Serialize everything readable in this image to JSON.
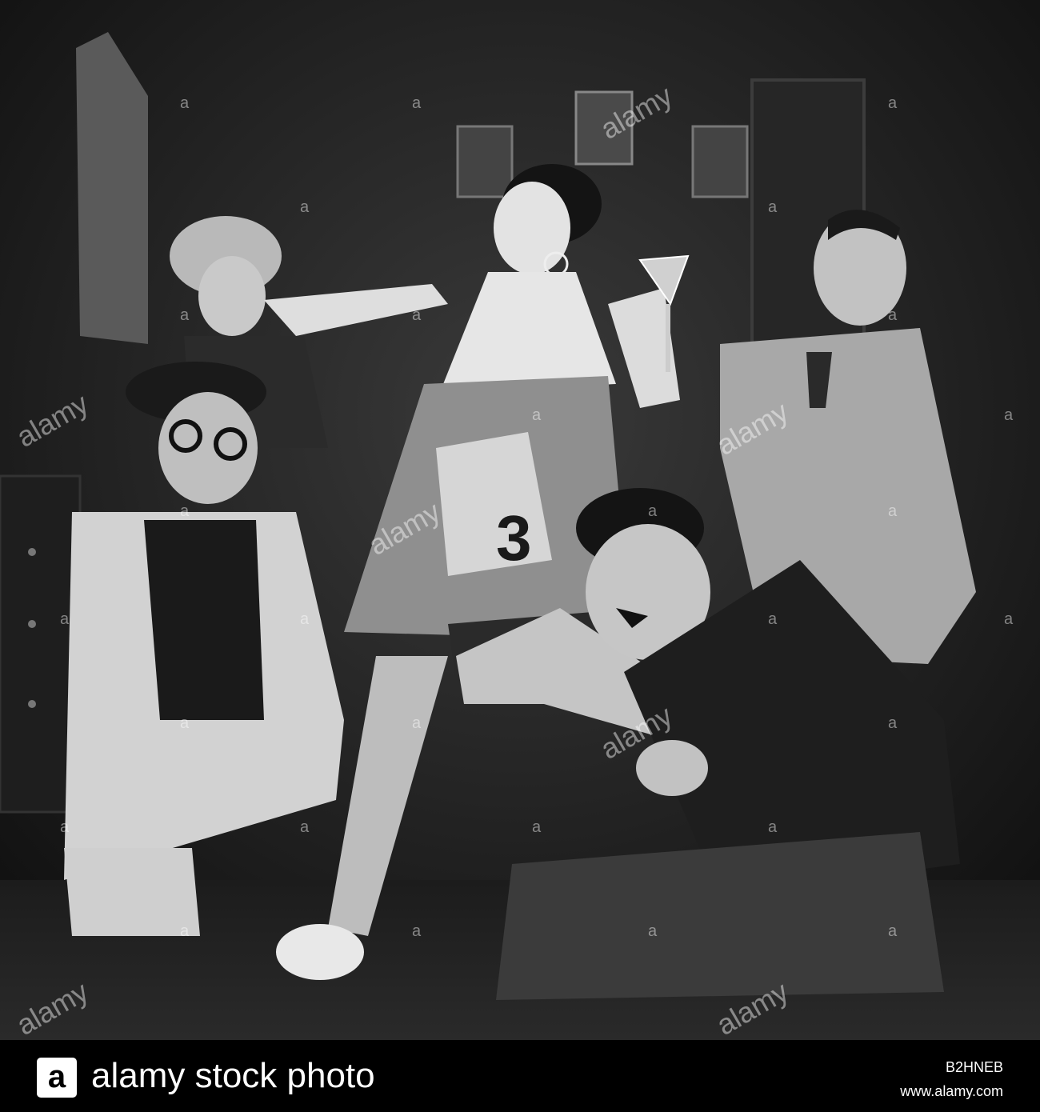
{
  "photo": {
    "number_on_dress": "3",
    "watermark_word": "alamy",
    "watermark_letter": "a"
  },
  "footer": {
    "logo_letter": "a",
    "brand": "alamy stock photo",
    "image_id": "B2HNEB",
    "site": "www.alamy.com"
  },
  "colors": {
    "footer_bg": "#000000",
    "footer_text": "#ffffff"
  }
}
